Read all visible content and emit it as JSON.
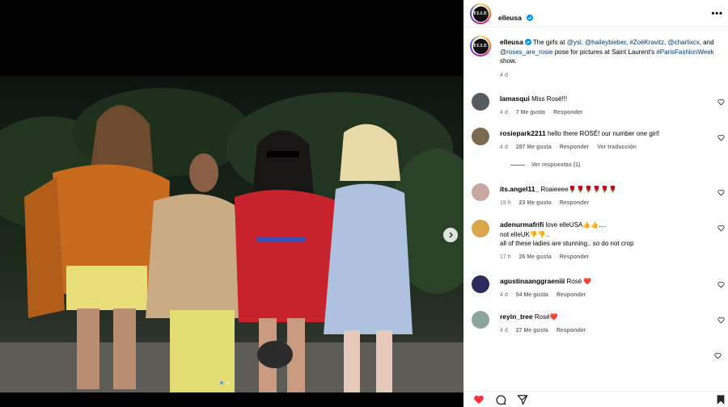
{
  "post": {
    "author": "elleusa",
    "logo_text": "ELLE",
    "caption": {
      "user": "elleusa",
      "t1": " The girls at ",
      "m1": "@ysl",
      "t2": ". ",
      "m2": "@haileybieber",
      "t3": ", ",
      "m3": "#ZoëKravitz",
      "t4": ", ",
      "m4": "@charlixcx",
      "t5": ", and ",
      "m5": "@roses_are_rosie",
      "t6": " pose for pictures at Saint Laurent's ",
      "m6": "#ParisFashionWeek",
      "t7": " show.",
      "time": "4 d"
    }
  },
  "labels": {
    "likes": "Me gusta",
    "reply": "Responder",
    "translate": "Ver traducción",
    "view_replies": "Ver respuestas (1)"
  },
  "comments": [
    {
      "user": "lamasqui",
      "text": "Miss Rosé!!!",
      "time": "4 d",
      "likes": "7",
      "avatar_color": "#555b5e"
    },
    {
      "user": "rosiepark2211",
      "text": "hello there ROSÉ! our number one girl!",
      "time": "4 d",
      "likes": "287",
      "avatar_color": "#7a6a4f"
    },
    {
      "user": "its.angel11_",
      "text": "Roaieeee🌹🌹🌹🌹🌹🌹",
      "time": "19 h",
      "likes": "23",
      "avatar_color": "#c9a7a0"
    },
    {
      "user": "adenurmafrifi",
      "line1": "love elleUSA👍👍....",
      "line2": "not elleUK👎👎..",
      "line3": "all of these ladies are stunning.. so do not crop",
      "time": "17 h",
      "likes": "26",
      "avatar_color": "#d9a64a"
    },
    {
      "user": "agustinaanggraeniii",
      "text": "Rosé ❤️",
      "time": "4 d",
      "likes": "54",
      "avatar_color": "#2b2a5e"
    },
    {
      "user": "reyin_tree",
      "text": "Rosé❤️",
      "time": "4 d",
      "likes": "27",
      "avatar_color": "#8aa59c"
    }
  ]
}
